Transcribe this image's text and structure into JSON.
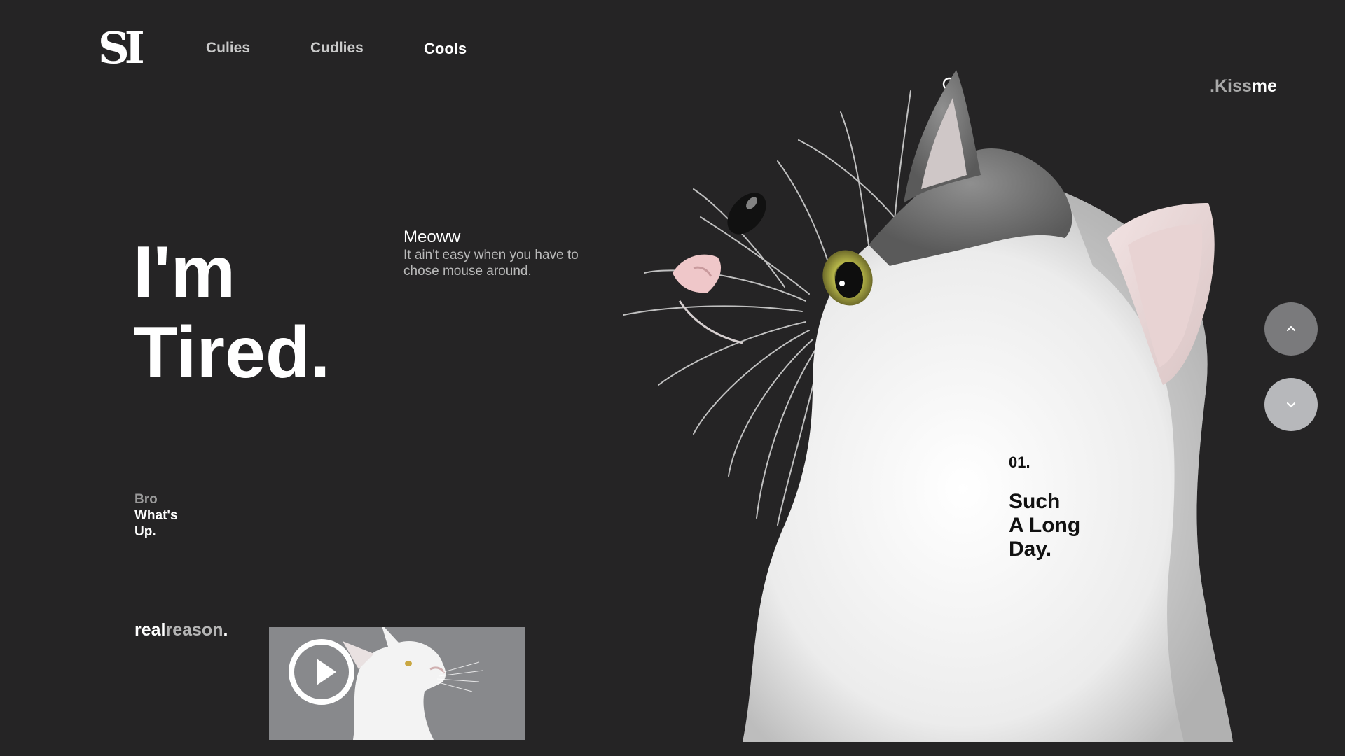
{
  "header": {
    "logo": "SI",
    "nav": [
      {
        "label": "Culies"
      },
      {
        "label": "Cudlies"
      },
      {
        "label": "Cools"
      }
    ],
    "search_icon": "search-icon",
    "cta": {
      "part1": ".Kiss",
      "part2": "me"
    }
  },
  "hero": {
    "title_line1": "I'm",
    "title_line2": "Tired.",
    "subtitle": "Meoww",
    "description": "It ain't easy when you have to chose mouse around."
  },
  "side": {
    "line1": "Bro",
    "line2": "What's",
    "line3": "Up."
  },
  "footer": {
    "part1": "real",
    "part2": "reason",
    "part3": "."
  },
  "video": {
    "icon": "play-icon"
  },
  "slide": {
    "number": "01.",
    "caption_line1": "Such",
    "caption_line2": "A Long",
    "caption_line3": "Day."
  },
  "controls": {
    "up_icon": "chevron-up-icon",
    "down_icon": "chevron-down-icon"
  },
  "colors": {
    "background": "#252425",
    "text": "#ffffff",
    "muted": "#a9a9a9"
  }
}
